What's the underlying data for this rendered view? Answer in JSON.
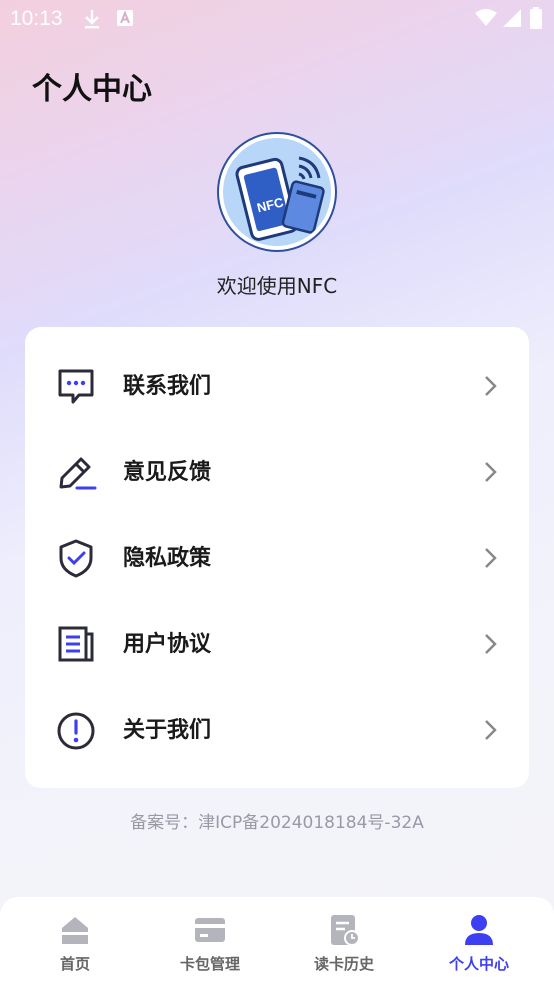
{
  "status_bar": {
    "time": "10:13"
  },
  "page": {
    "title": "个人中心"
  },
  "profile": {
    "avatar_text": "NFC",
    "welcome": "欢迎使用NFC"
  },
  "menu": {
    "items": [
      {
        "label": "联系我们",
        "icon": "chat-bubble-icon"
      },
      {
        "label": "意见反馈",
        "icon": "pencil-icon"
      },
      {
        "label": "隐私政策",
        "icon": "shield-check-icon"
      },
      {
        "label": "用户协议",
        "icon": "document-icon"
      },
      {
        "label": "关于我们",
        "icon": "info-exclamation-icon"
      }
    ]
  },
  "footer": {
    "icp": "备案号：津ICP备2024018184号-32A"
  },
  "tabs": [
    {
      "label": "首页",
      "icon": "home-icon",
      "active": false
    },
    {
      "label": "卡包管理",
      "icon": "card-icon",
      "active": false
    },
    {
      "label": "读卡历史",
      "icon": "history-icon",
      "active": false
    },
    {
      "label": "个人中心",
      "icon": "user-icon",
      "active": true
    }
  ],
  "colors": {
    "accent": "#3d3ff2",
    "icon_dark": "#2b2b3a",
    "avatar_bg": "#b7d6f8",
    "avatar_border": "#2f4fa0"
  }
}
